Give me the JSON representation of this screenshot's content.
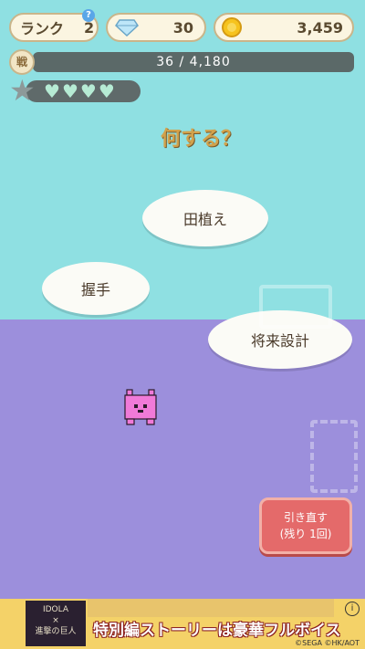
{
  "header": {
    "rank_label": "ランク",
    "rank_value": "2",
    "rank_help": "?",
    "gems": "30",
    "coins": "3,459",
    "gem_icon": "diamond-icon",
    "coin_icon": "coin-icon"
  },
  "xp": {
    "icon_text": "戦",
    "text": "36 / 4,180",
    "current": 36,
    "max": 4180
  },
  "hearts": {
    "filled": 4,
    "total": 4,
    "icon": "star-icon"
  },
  "prompt": "何する？",
  "choices": [
    "田植え",
    "握手",
    "将来設計"
  ],
  "redo_button": {
    "line1": "引き直す",
    "line2": "(残り 1回)"
  },
  "ad": {
    "logo_line1": "IDOLA",
    "logo_line2": "×",
    "logo_line3": "進撃の巨人",
    "text": "特別編ストーリーは豪華フルボイス",
    "copyright": "©SEGA ©HK/AOT",
    "info": "i"
  },
  "colors": {
    "sky": "#8fe0e2",
    "ground": "#9c8fdc",
    "creature": "#f07ad8",
    "redo": "#e46a6a"
  }
}
